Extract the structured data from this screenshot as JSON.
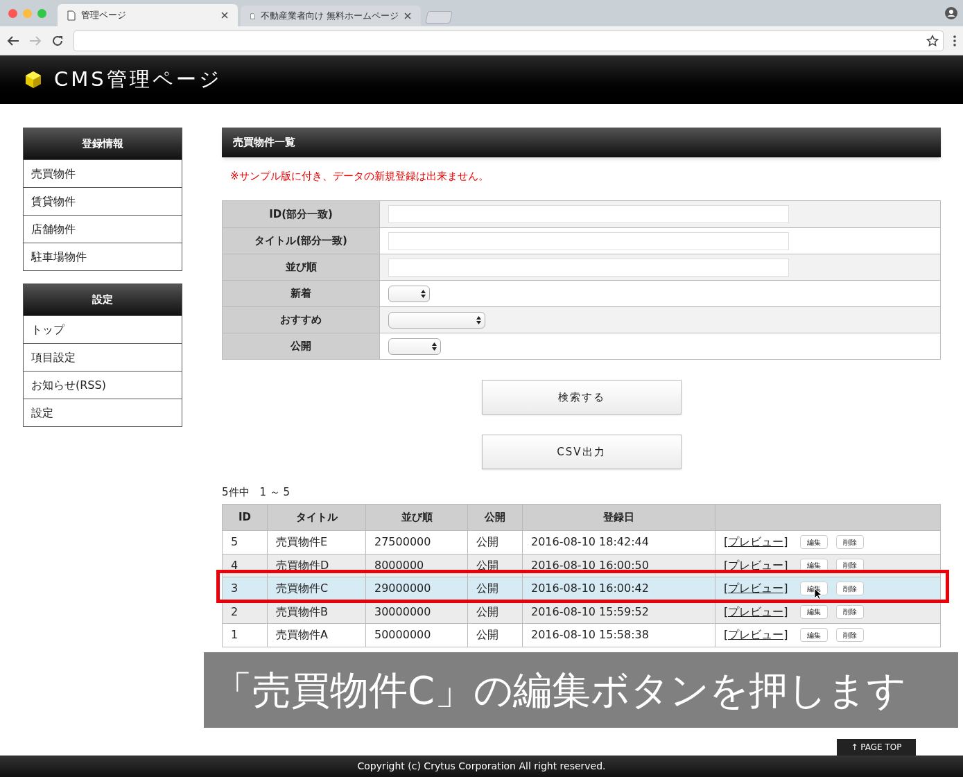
{
  "browser": {
    "tabs": [
      {
        "title": "管理ページ",
        "selected": true
      },
      {
        "title": "不動産業者向け 無料ホームページ",
        "selected": false
      }
    ]
  },
  "header": {
    "title": "CMS管理ページ"
  },
  "sidebar": {
    "sections": [
      {
        "heading": "登録情報",
        "items": [
          "売買物件",
          "賃貸物件",
          "店舗物件",
          "駐車場物件"
        ]
      },
      {
        "heading": "設定",
        "items": [
          "トップ",
          "項目設定",
          "お知らせ(RSS)",
          "設定"
        ]
      }
    ]
  },
  "main": {
    "heading": "売買物件一覧",
    "notice": "※サンプル版に付き、データの新規登録は出来ません。",
    "search_fields": [
      {
        "label": "ID(部分一致)",
        "kind": "text"
      },
      {
        "label": "タイトル(部分一致)",
        "kind": "text"
      },
      {
        "label": "並び順",
        "kind": "text"
      },
      {
        "label": "新着",
        "kind": "select"
      },
      {
        "label": "おすすめ",
        "kind": "select"
      },
      {
        "label": "公開",
        "kind": "select"
      }
    ],
    "buttons": [
      "検索する",
      "CSV出力"
    ],
    "pagination": "5件中　1 ～ 5",
    "table": {
      "columns": [
        "ID",
        "タイトル",
        "並び順",
        "公開",
        "登録日"
      ],
      "rows": [
        {
          "cells": [
            "5",
            "売買物件E",
            "27500000",
            "公開",
            "2016-08-10 18:42:44"
          ],
          "selected": false,
          "preview": "[プレビュー]",
          "edit": "編集",
          "delete": "削除"
        },
        {
          "cells": [
            "4",
            "売買物件D",
            "8000000",
            "公開",
            "2016-08-10 16:00:50"
          ],
          "selected": false,
          "preview": "[プレビュー]",
          "edit": "編集",
          "delete": "削除"
        },
        {
          "cells": [
            "3",
            "売買物件C",
            "29000000",
            "公開",
            "2016-08-10 16:00:42"
          ],
          "selected": true,
          "preview": "[プレビュー]",
          "edit": "編集",
          "delete": "削除"
        },
        {
          "cells": [
            "2",
            "売買物件B",
            "30000000",
            "公開",
            "2016-08-10 15:59:52"
          ],
          "selected": false,
          "preview": "[プレビュー]",
          "edit": "編集",
          "delete": "削除"
        },
        {
          "cells": [
            "1",
            "売買物件A",
            "50000000",
            "公開",
            "2016-08-10 15:58:38"
          ],
          "selected": false,
          "preview": "[プレビュー]",
          "edit": "編集",
          "delete": "削除"
        }
      ]
    }
  },
  "caption": "「売買物件C」の編集ボタンを押します",
  "page_top": "↑ PAGE TOP",
  "footer": "Copyright (c) Crytus Corporation All right reserved."
}
